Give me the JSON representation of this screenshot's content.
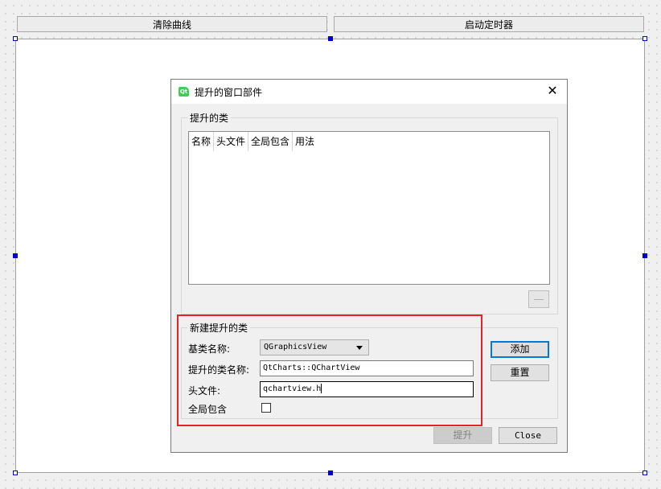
{
  "top_buttons": {
    "clear_label": "清除曲线",
    "start_timer_label": "启动定时器"
  },
  "dialog": {
    "icon_text": "Qt",
    "title": "提升的窗口部件",
    "close_glyph": "✕",
    "promoted_classes": {
      "group_label": "提升的类",
      "columns": [
        "名称",
        "头文件",
        "全局包含",
        "用法"
      ],
      "rows": []
    },
    "new_class": {
      "group_label": "新建提升的类",
      "base_class_label": "基类名称:",
      "base_class_value": "QGraphicsView",
      "promoted_name_label": "提升的类名称:",
      "promoted_name_value": "QtCharts::QChartView",
      "header_label": "头文件:",
      "header_value": "qchartview.h",
      "global_include_label": "全局包含",
      "global_include_checked": false
    },
    "add_label": "添加",
    "reset_label": "重置",
    "promote_label": "提升",
    "close_label": "Close"
  },
  "colors": {
    "accent_focus": "#0078d7",
    "highlight_box": "#e8202a",
    "qt_icon": "#41cd52",
    "selection_handle": "#0000cc"
  }
}
